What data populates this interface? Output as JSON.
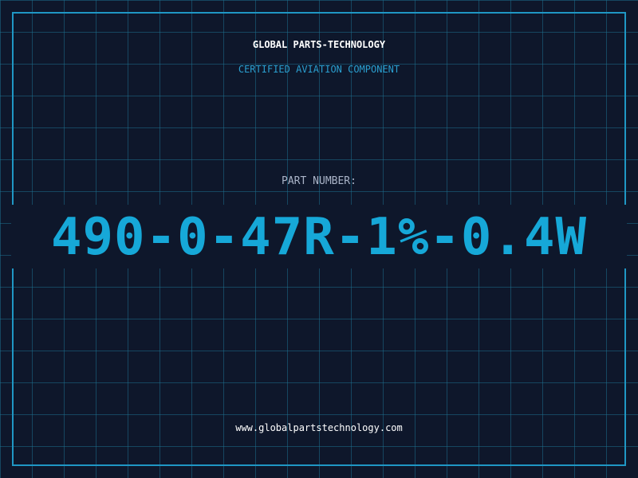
{
  "header": {
    "brand": "GLOBAL PARTS-TECHNOLOGY",
    "subtitle": "CERTIFIED AVIATION COMPONENT"
  },
  "part": {
    "label": "PART NUMBER:",
    "number": "490-0-47R-1%-0.4W"
  },
  "footer": {
    "url": "www.globalpartstechnology.com"
  },
  "colors": {
    "background": "#0e172b",
    "grid": "#1e6e8c",
    "frame": "#1f97c4",
    "accent": "#16a8d8",
    "subtitle": "#2a9fd0",
    "label": "#aab4c8",
    "text": "#ffffff"
  }
}
